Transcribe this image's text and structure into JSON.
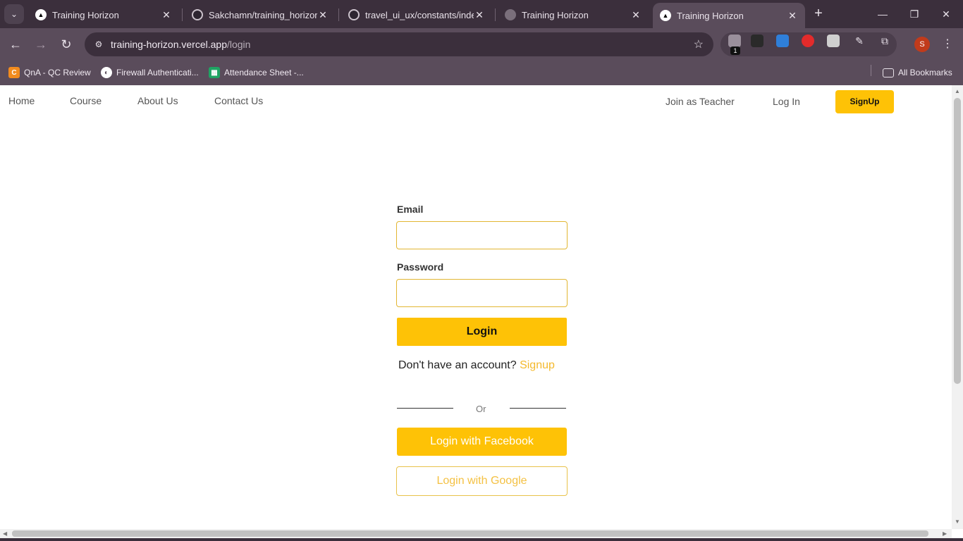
{
  "browser": {
    "tabs": [
      {
        "title": "Training Horizon",
        "icon": "vercel-icon"
      },
      {
        "title": "Sakchamn/training_horizon",
        "icon": "github-icon"
      },
      {
        "title": "travel_ui_ux/constants/index",
        "icon": "github-icon"
      },
      {
        "title": "Training Horizon",
        "icon": "globe-icon"
      },
      {
        "title": "Training Horizon",
        "icon": "vercel-icon",
        "active": true
      }
    ],
    "url": {
      "host": "training-horizon.vercel.app",
      "path": "/login"
    },
    "extension_badge": "1",
    "profile_initial": "S",
    "bookmarks": [
      {
        "label": "QnA - QC Review",
        "icon": "c-logo-icon",
        "color": "#f28b1e"
      },
      {
        "label": "Firewall Authenticati...",
        "icon": "globe-icon",
        "color": "#ffffff"
      },
      {
        "label": "Attendance Sheet -...",
        "icon": "sheets-icon",
        "color": "#1fa463"
      }
    ],
    "all_bookmarks_label": "All Bookmarks"
  },
  "nav": {
    "home": "Home",
    "course": "Course",
    "about": "About Us",
    "contact": "Contact Us",
    "join_teacher": "Join as Teacher",
    "login": "Log In",
    "signup": "SignUp"
  },
  "form": {
    "email_label": "Email",
    "email_value": "",
    "password_label": "Password",
    "password_value": "",
    "login_button": "Login",
    "no_account_text": "Don't have an account?",
    "signup_link": "Signup",
    "or_text": "Or",
    "facebook_button": "Login with Facebook",
    "google_button": "Login with Google"
  },
  "colors": {
    "accent": "#fec206",
    "browser_dark": "#3b2f3c",
    "browser_mid": "#5a4c5b"
  }
}
